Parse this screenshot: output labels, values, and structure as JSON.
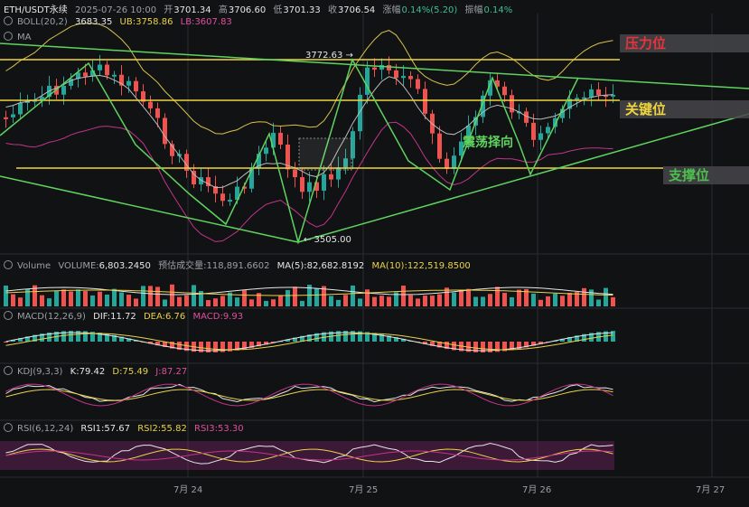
{
  "header": {
    "symbol": "ETH/USDT永续",
    "time": "2025-07-26 10:00",
    "open_label": "开",
    "open": "3701.34",
    "high_label": "高",
    "high": "3706.60",
    "low_label": "低",
    "low": "3701.33",
    "close_label": "收",
    "close": "3706.54",
    "change_label": "涨幅",
    "change": "0.14%(5.20)",
    "amp_label": "振幅",
    "amp": "0.14%"
  },
  "boll": {
    "name": "BOLL(20,2)",
    "mid": "3683.35",
    "ub_label": "UB:",
    "ub": "3758.86",
    "lb_label": "LB:",
    "lb": "3607.83"
  },
  "ma": {
    "name": "MA"
  },
  "volume": {
    "name": "Volume",
    "vol_label": "VOLUME:",
    "vol": "6,803.2450",
    "est_label": "预估成交量:",
    "est": "118,891.6602",
    "ma5": "MA(5):82,682.8192",
    "ma10": "MA(10):122,519.8500"
  },
  "macd": {
    "name": "MACD(12,26,9)",
    "dif": "DIF:11.72",
    "dea": "DEA:6.76",
    "macd": "MACD:9.93"
  },
  "kdj": {
    "name": "KDJ(9,3,3)",
    "k": "K:79.42",
    "d": "D:75.49",
    "j": "J:87.27"
  },
  "rsi": {
    "name": "RSI(6,12,24)",
    "rsi1": "RSI1:57.67",
    "rsi2": "RSI2:55.82",
    "rsi3": "RSI3:53.30"
  },
  "annotations": {
    "high_price": "3772.63 →",
    "low_price": "← 3505.00",
    "resistance": "压力位",
    "key_level": "关键位",
    "support": "支撑位",
    "consolidation": "震荡择向"
  },
  "colors": {
    "resistance": "#e8343a",
    "key_level": "#f0d53c",
    "support": "#4cc04c",
    "consolidation": "#5fd35f",
    "up": "#26a69a",
    "down": "#ef5350"
  },
  "dates": [
    "7月 24",
    "7月 25",
    "7月 26",
    "7月 27"
  ]
}
